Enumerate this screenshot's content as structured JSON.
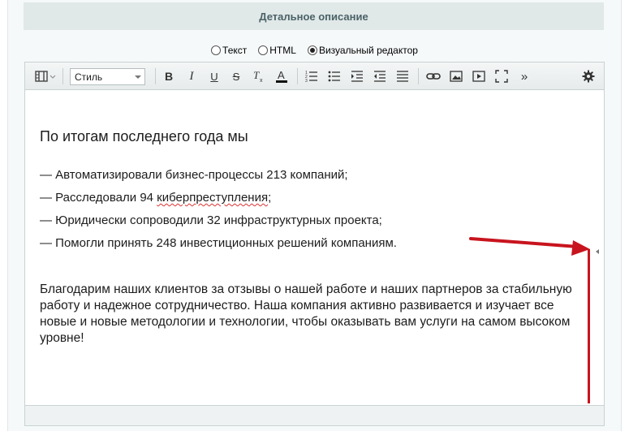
{
  "section": {
    "title": "Детальное описание"
  },
  "mode_switch": {
    "options": [
      {
        "label": "Текст",
        "checked": false
      },
      {
        "label": "HTML",
        "checked": false
      },
      {
        "label": "Визуальный редактор",
        "checked": true
      }
    ]
  },
  "toolbar": {
    "style_select": {
      "value": "Стиль"
    },
    "buttons": {
      "bold": "B",
      "italic": "I",
      "underline": "U",
      "strike": "S",
      "more": "»"
    },
    "icons": [
      "template-icon",
      "bold-icon",
      "italic-icon",
      "underline-icon",
      "strikethrough-icon",
      "remove-format-icon",
      "font-color-icon",
      "ordered-list-icon",
      "unordered-list-icon",
      "outdent-icon",
      "indent-icon",
      "justify-icon",
      "link-icon",
      "image-icon",
      "video-icon",
      "fullscreen-icon",
      "more-icon",
      "settings-icon"
    ]
  },
  "content": {
    "headline": "По итогам последнего года мы",
    "list": [
      {
        "text": "— Автоматизировали бизнес-процессы 213 компаний;"
      },
      {
        "prefix": "— Расследовали 94 ",
        "spell": "киберпреступления",
        "suffix": ";"
      },
      {
        "text": "— Юридически сопроводили 32 инфраструктурных проекта;"
      },
      {
        "text": "— Помогли принять 248 инвестиционных решений компаниям."
      }
    ],
    "paragraph": "Благодарим наших клиентов за отзывы о нашей работе и наших партнеров за стабильную работу и надежное сотрудничество. Наша компания активно развивается и изучает все новые и новые методологии и технологии, чтобы оказывать вам услуги на самом высоком уровне!"
  },
  "colors": {
    "header_bg": "#e0e8e8",
    "header_text": "#4b6267",
    "annotation_red": "#c8141e"
  }
}
